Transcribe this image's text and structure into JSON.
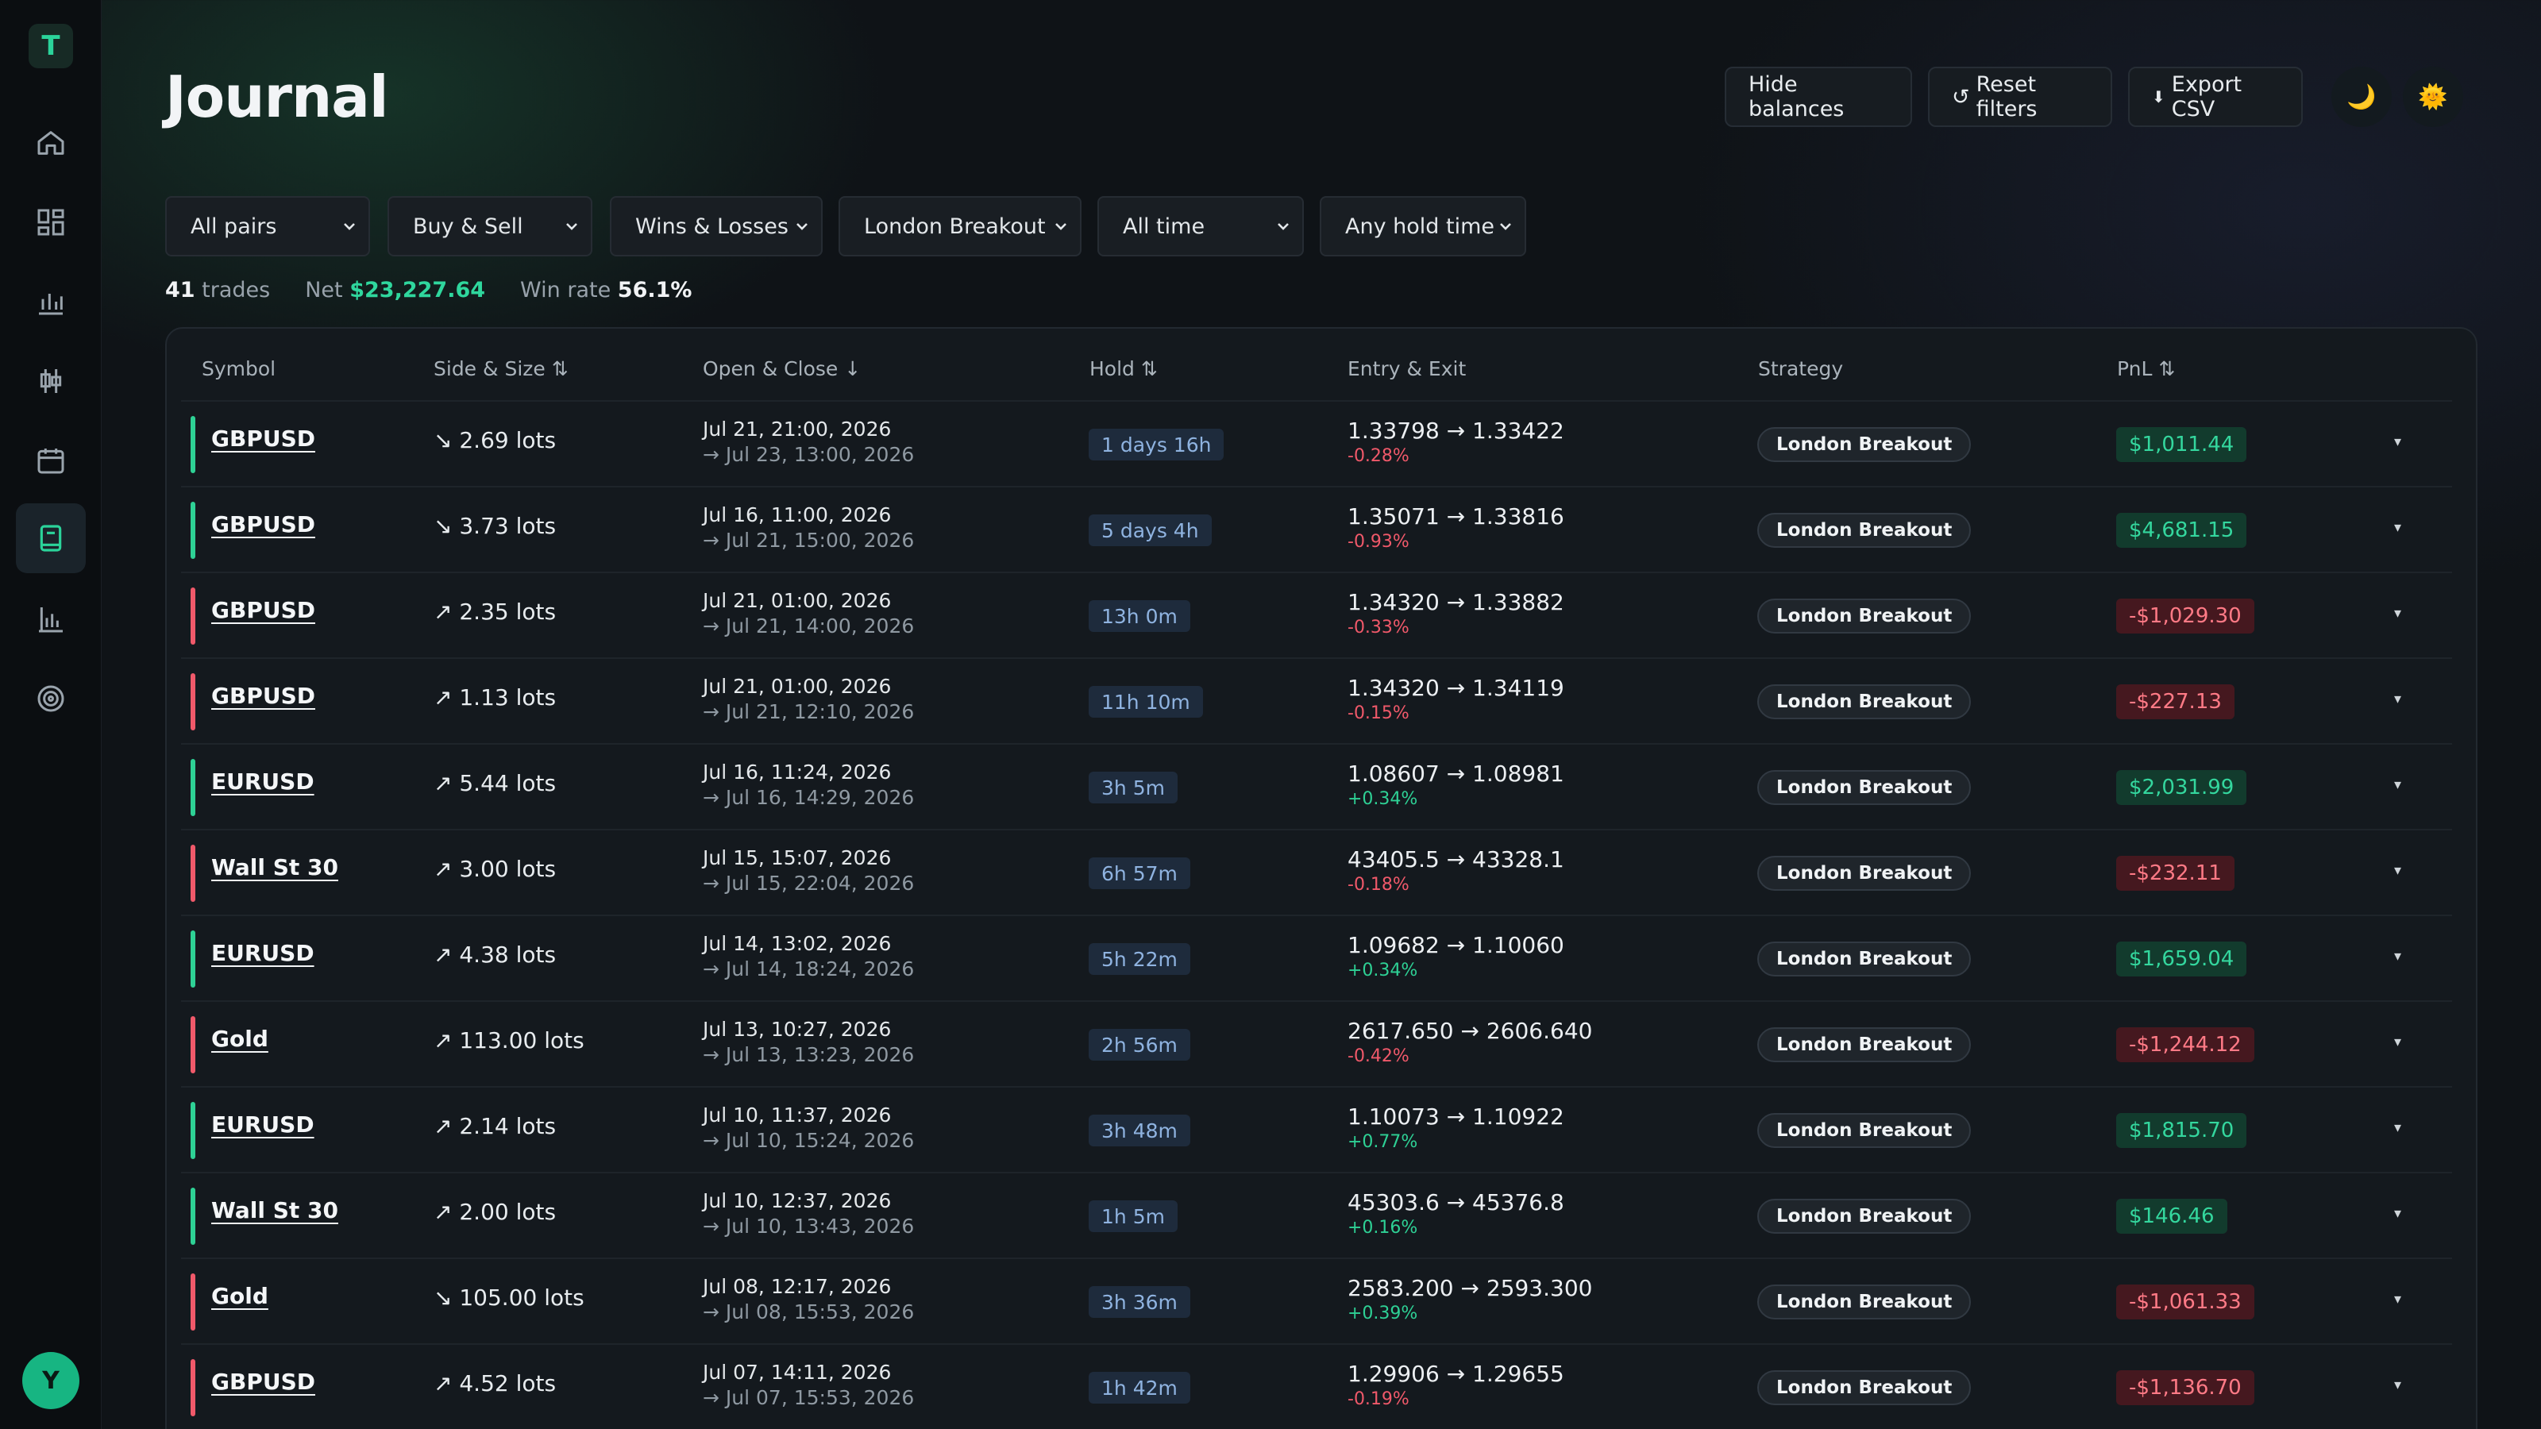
{
  "app": {
    "logo_letter": "T",
    "user_initial": "Y"
  },
  "sidebar": {
    "items": [
      {
        "icon": "home-icon"
      },
      {
        "icon": "dashboard-icon"
      },
      {
        "icon": "bar-chart-icon"
      },
      {
        "icon": "candlestick-icon"
      },
      {
        "icon": "calendar-icon"
      },
      {
        "icon": "journal-icon",
        "active": true
      },
      {
        "icon": "analytics-icon"
      },
      {
        "icon": "target-icon"
      }
    ]
  },
  "header": {
    "title": "Journal",
    "hide_balances": "Hide balances",
    "reset_filters": "Reset filters",
    "export_csv": "Export CSV",
    "reset_glyph": "↺",
    "export_glyph": "⬇",
    "moon_glyph": "🌙",
    "sun_glyph": "🌞"
  },
  "filters": {
    "pairs": "All pairs",
    "side": "Buy & Sell",
    "outcome": "Wins & Losses",
    "strategy": "London Breakout",
    "period": "All time",
    "hold": "Any hold time"
  },
  "summary": {
    "trades_count": "41",
    "trades_label": "trades",
    "net_label": "Net",
    "net_value": "$23,227.64",
    "winrate_label": "Win rate",
    "winrate_value": "56.1%"
  },
  "table": {
    "columns": {
      "symbol": "Symbol",
      "side": "Side & Size ⇅",
      "open_close": "Open & Close ↓",
      "hold": "Hold ⇅",
      "entry_exit": "Entry & Exit",
      "strategy": "Strategy",
      "pnl": "PnL ⇅"
    },
    "rows": [
      {
        "symbol": "GBPUSD",
        "win": true,
        "side": "↘ 2.69 lots",
        "open": "Jul 21, 21:00, 2026",
        "close": "→ Jul 23, 13:00, 2026",
        "hold": "1 days 16h",
        "entry": "1.33798 → 1.33422",
        "pct": "-0.28%",
        "pct_pos": false,
        "strategy": "London Breakout",
        "pnl": "$1,011.44"
      },
      {
        "symbol": "GBPUSD",
        "win": true,
        "side": "↘ 3.73 lots",
        "open": "Jul 16, 11:00, 2026",
        "close": "→ Jul 21, 15:00, 2026",
        "hold": "5 days 4h",
        "entry": "1.35071 → 1.33816",
        "pct": "-0.93%",
        "pct_pos": false,
        "strategy": "London Breakout",
        "pnl": "$4,681.15"
      },
      {
        "symbol": "GBPUSD",
        "win": false,
        "side": "↗ 2.35 lots",
        "open": "Jul 21, 01:00, 2026",
        "close": "→ Jul 21, 14:00, 2026",
        "hold": "13h 0m",
        "entry": "1.34320 → 1.33882",
        "pct": "-0.33%",
        "pct_pos": false,
        "strategy": "London Breakout",
        "pnl": "-$1,029.30"
      },
      {
        "symbol": "GBPUSD",
        "win": false,
        "side": "↗ 1.13 lots",
        "open": "Jul 21, 01:00, 2026",
        "close": "→ Jul 21, 12:10, 2026",
        "hold": "11h 10m",
        "entry": "1.34320 → 1.34119",
        "pct": "-0.15%",
        "pct_pos": false,
        "strategy": "London Breakout",
        "pnl": "-$227.13"
      },
      {
        "symbol": "EURUSD",
        "win": true,
        "side": "↗ 5.44 lots",
        "open": "Jul 16, 11:24, 2026",
        "close": "→ Jul 16, 14:29, 2026",
        "hold": "3h 5m",
        "entry": "1.08607 → 1.08981",
        "pct": "+0.34%",
        "pct_pos": true,
        "strategy": "London Breakout",
        "pnl": "$2,031.99"
      },
      {
        "symbol": "Wall St 30",
        "win": false,
        "side": "↗ 3.00 lots",
        "open": "Jul 15, 15:07, 2026",
        "close": "→ Jul 15, 22:04, 2026",
        "hold": "6h 57m",
        "entry": "43405.5 → 43328.1",
        "pct": "-0.18%",
        "pct_pos": false,
        "strategy": "London Breakout",
        "pnl": "-$232.11"
      },
      {
        "symbol": "EURUSD",
        "win": true,
        "side": "↗ 4.38 lots",
        "open": "Jul 14, 13:02, 2026",
        "close": "→ Jul 14, 18:24, 2026",
        "hold": "5h 22m",
        "entry": "1.09682 → 1.10060",
        "pct": "+0.34%",
        "pct_pos": true,
        "strategy": "London Breakout",
        "pnl": "$1,659.04"
      },
      {
        "symbol": "Gold",
        "win": false,
        "side": "↗ 113.00 lots",
        "open": "Jul 13, 10:27, 2026",
        "close": "→ Jul 13, 13:23, 2026",
        "hold": "2h 56m",
        "entry": "2617.650 → 2606.640",
        "pct": "-0.42%",
        "pct_pos": false,
        "strategy": "London Breakout",
        "pnl": "-$1,244.12"
      },
      {
        "symbol": "EURUSD",
        "win": true,
        "side": "↗ 2.14 lots",
        "open": "Jul 10, 11:37, 2026",
        "close": "→ Jul 10, 15:24, 2026",
        "hold": "3h 48m",
        "entry": "1.10073 → 1.10922",
        "pct": "+0.77%",
        "pct_pos": true,
        "strategy": "London Breakout",
        "pnl": "$1,815.70"
      },
      {
        "symbol": "Wall St 30",
        "win": true,
        "side": "↗ 2.00 lots",
        "open": "Jul 10, 12:37, 2026",
        "close": "→ Jul 10, 13:43, 2026",
        "hold": "1h 5m",
        "entry": "45303.6 → 45376.8",
        "pct": "+0.16%",
        "pct_pos": true,
        "strategy": "London Breakout",
        "pnl": "$146.46"
      },
      {
        "symbol": "Gold",
        "win": false,
        "side": "↘ 105.00 lots",
        "open": "Jul 08, 12:17, 2026",
        "close": "→ Jul 08, 15:53, 2026",
        "hold": "3h 36m",
        "entry": "2583.200 → 2593.300",
        "pct": "+0.39%",
        "pct_pos": true,
        "strategy": "London Breakout",
        "pnl": "-$1,061.33"
      },
      {
        "symbol": "GBPUSD",
        "win": false,
        "side": "↗ 4.52 lots",
        "open": "Jul 07, 14:11, 2026",
        "close": "→ Jul 07, 15:53, 2026",
        "hold": "1h 42m",
        "entry": "1.29906 → 1.29655",
        "pct": "-0.19%",
        "pct_pos": false,
        "strategy": "London Breakout",
        "pnl": "-$1,136.70"
      }
    ]
  },
  "colors": {
    "win": "#2ed195",
    "loss": "#f0596a",
    "accent": "#17b582"
  }
}
